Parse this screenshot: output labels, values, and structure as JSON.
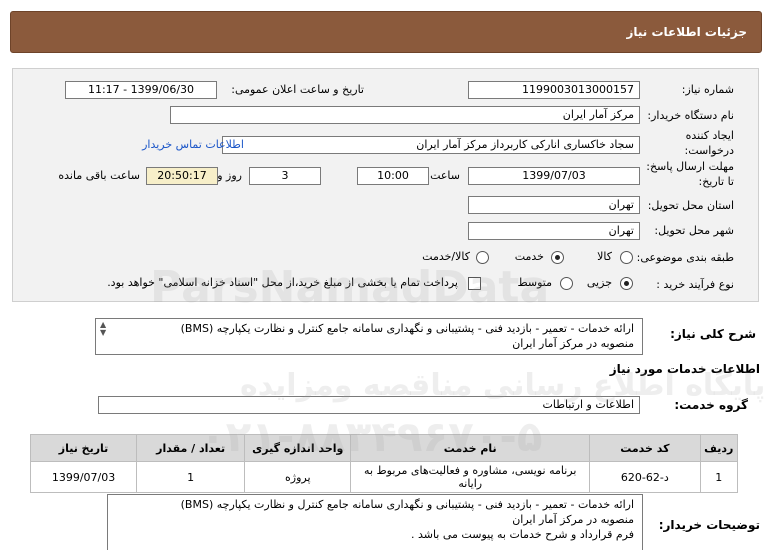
{
  "header": {
    "title": "جزئیات اطلاعات نیاز"
  },
  "form": {
    "need_number_label": "شماره نیاز:",
    "need_number": "1199003013000157",
    "announce_label": "تاریخ و ساعت اعلان عمومی:",
    "announce_value": "1399/06/30 - 11:17",
    "buyer_label": "نام دستگاه خریدار:",
    "buyer_value": "مرکز آمار ایران",
    "creator_label_1": "ایجاد کننده",
    "creator_label_2": "درخواست:",
    "creator_value": "سجاد خاکساری انارکی کاربرداز مرکز آمار ایران",
    "contact_link": "اطلاعات تماس خریدار",
    "deadline_label_1": "مهلت ارسال پاسخ:",
    "deadline_label_2": "تا تاریخ:",
    "deadline_date": "1399/07/03",
    "time_label": "ساعت",
    "deadline_time": "10:00",
    "days_value": "3",
    "days_label": "روز و",
    "remaining_time": "20:50:17",
    "remaining_label": "ساعت باقی مانده",
    "province_label": "استان محل تحویل:",
    "province_value": "تهران",
    "city_label": "شهر محل تحویل:",
    "city_value": "تهران",
    "category_label": "طبقه بندی موضوعی:",
    "category_options": [
      "کالا",
      "خدمت",
      "کالا/خدمت"
    ],
    "category_selected": "خدمت",
    "purchase_label": "نوع فرآیند خرید :",
    "purchase_options": [
      "جزیی",
      "متوسط"
    ],
    "purchase_selected": "جزیی",
    "treasury_note": "پرداخت تمام یا بخشی از مبلغ خرید،از محل \"اسناد خزانه اسلامی\" خواهد بود."
  },
  "summary": {
    "label": "شرح کلی نیاز:",
    "line1": "ارائه خدمات - تعمیر - بازدید فنی - پشتیبانی و نگهداری سامانه جامع کنترل و نظارت یکپارچه (BMS)",
    "line2": "منصوبه در مرکز آمار ایران"
  },
  "services": {
    "section_title": "اطلاعات خدمات مورد نیاز",
    "group_label": "گروه خدمت:",
    "group_value": "اطلاعات و ارتباطات",
    "columns": [
      "ردیف",
      "کد خدمت",
      "نام خدمت",
      "واحد اندازه گیری",
      "تعداد / مقدار",
      "تاریخ نیاز"
    ],
    "rows": [
      {
        "row": "1",
        "code": "د-62-620",
        "name": "برنامه نویسی، مشاوره و فعالیت‌های مربوط به رایانه",
        "unit": "پروژه",
        "qty": "1",
        "date": "1399/07/03"
      }
    ]
  },
  "buyer_notes": {
    "label": "توضیحات خریدار:",
    "line1": "ارائه خدمات - تعمیر - بازدید فنی - پشتیبانی و نگهداری سامانه جامع کنترل و نظارت یکپارچه (BMS)",
    "line2": "منصوبه در مرکز آمار ایران",
    "line3": "فرم قرارداد و شرح خدمات به پیوست می باشد ."
  },
  "watermark": {
    "line1": "ParsNamadData",
    "line2": "پایگاه اطلاع رسانی مناقصه ومزایده",
    "line3": "۰۲۱-۸۸۳۴۹۶۷۰-۵"
  }
}
